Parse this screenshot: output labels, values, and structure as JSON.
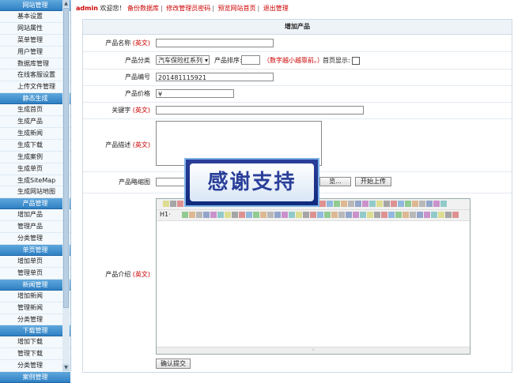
{
  "topbar": {
    "admin": "admin",
    "welcome": "欢迎您！",
    "links": [
      "备份数据库",
      "修改管理员密码",
      "预览网站首页",
      "退出管理"
    ]
  },
  "sidebar": {
    "sections": [
      {
        "title": "网站管理",
        "items": [
          "基本设置",
          "网站属性",
          "菜单管理",
          "用户管理",
          "数据库管理",
          "在线客服设置",
          "上传文件管理"
        ]
      },
      {
        "title": "静态生成",
        "items": [
          "生成首页",
          "生成产品",
          "生成新闻",
          "生成下载",
          "生成案例",
          "生成单页",
          "生成SiteMap",
          "生成网站地图"
        ]
      },
      {
        "title": "产品管理",
        "items": [
          "增加产品",
          "管理产品",
          "分类管理"
        ]
      },
      {
        "title": "单页管理",
        "items": [
          "增加单页",
          "管理单页"
        ]
      },
      {
        "title": "新闻管理",
        "items": [
          "增加新闻",
          "管理新闻",
          "分类管理"
        ]
      },
      {
        "title": "下载管理",
        "items": [
          "增加下载",
          "管理下载",
          "分类管理"
        ]
      },
      {
        "title": "案例管理",
        "items": []
      }
    ]
  },
  "form": {
    "title": "增加产品",
    "name_label": "产品名称",
    "en": "(英文)",
    "category_label": "产品分类",
    "category_value": "汽车保险杠系列",
    "sort_label": "产品排序:",
    "sort_hint": "（数字越小越靠前。）",
    "home_label": "首页显示:",
    "code_label": "产品编号",
    "code_value": "201481115921",
    "price_label": "产品价格",
    "price_value": "¥",
    "keyword_label": "关键字",
    "desc_label": "产品描述",
    "thumb_label": "产品略缩图",
    "browse_btn": "览...",
    "upload_btn": "开始上传",
    "intro_label": "产品介绍",
    "editor_format": "H1·",
    "submit_btn": "确认提交"
  },
  "banner": {
    "text": "感谢支持"
  },
  "colors": {
    "accent": "#2f80c4",
    "link": "#cc0000",
    "banner": "#1a3289"
  }
}
